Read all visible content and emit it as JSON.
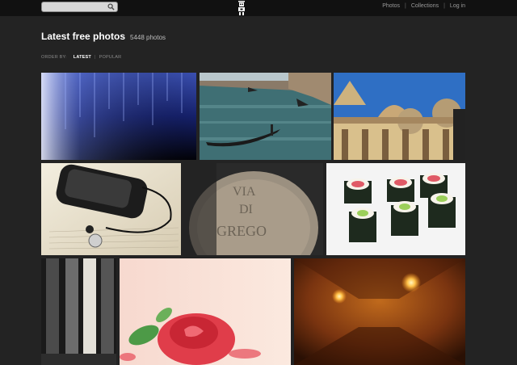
{
  "search": {
    "value": "",
    "icon": "search-icon"
  },
  "nav": {
    "photos": "Photos",
    "collections": "Collections",
    "login": "Log in",
    "sep": "|"
  },
  "page": {
    "title": "Latest free photos",
    "count": "5448 photos"
  },
  "order": {
    "label": "ORDER BY:",
    "latest": "LATEST",
    "popular": "POPULAR",
    "sep": "|"
  },
  "photos": [
    {
      "subject": "blue light streaks"
    },
    {
      "subject": "venice canal gondola"
    },
    {
      "subject": "st marks basilica"
    },
    {
      "subject": "phone and earphones on book"
    },
    {
      "subject": "via di gregorio stone"
    },
    {
      "subject": "sushi rolls"
    },
    {
      "subject": "marble columns"
    },
    {
      "subject": "red rose"
    },
    {
      "subject": "lit cave tunnel"
    }
  ],
  "colors": {
    "background": "#232323",
    "topbar": "#111111",
    "link": "#9a9a9a",
    "title": "#ffffff"
  }
}
